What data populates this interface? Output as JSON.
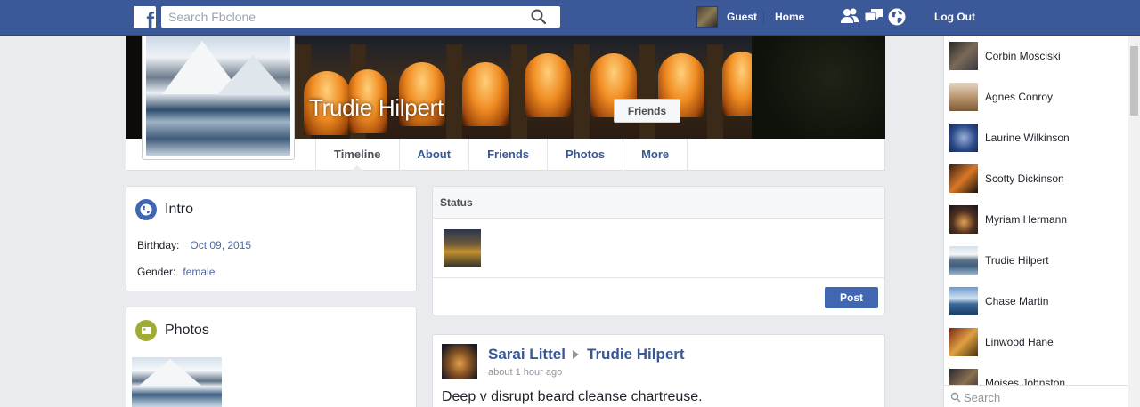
{
  "header": {
    "logo_letter": "f",
    "search_placeholder": "Search Fbclone",
    "user_label": "Guest",
    "home_label": "Home",
    "logout_label": "Log Out",
    "icons": [
      "friend-requests-icon",
      "messages-icon",
      "notifications-globe-icon"
    ]
  },
  "profile": {
    "name": "Trudie Hilpert",
    "friends_button": "Friends",
    "tabs": [
      {
        "label": "Timeline",
        "active": true
      },
      {
        "label": "About",
        "active": false
      },
      {
        "label": "Friends",
        "active": false
      },
      {
        "label": "Photos",
        "active": false
      },
      {
        "label": "More",
        "active": false
      }
    ]
  },
  "intro": {
    "title": "Intro",
    "birthday_label": "Birthday:",
    "birthday_value": "Oct 09, 2015",
    "gender_label": "Gender:",
    "gender_value": "female"
  },
  "photos": {
    "title": "Photos"
  },
  "status": {
    "title": "Status",
    "post_button": "Post"
  },
  "post": {
    "author": "Sarai Littel",
    "target": "Trudie Hilpert",
    "time": "about 1 hour ago",
    "text": "Deep v disrupt beard cleanse chartreuse."
  },
  "contacts": [
    {
      "name": "Corbin Mosciski"
    },
    {
      "name": "Agnes Conroy"
    },
    {
      "name": "Laurine Wilkinson"
    },
    {
      "name": "Scotty Dickinson"
    },
    {
      "name": "Myriam Hermann"
    },
    {
      "name": "Trudie Hilpert"
    },
    {
      "name": "Chase Martin"
    },
    {
      "name": "Linwood Hane"
    },
    {
      "name": "Moises Johnston"
    }
  ],
  "sidebar_search_placeholder": "Search",
  "colors": {
    "brand": "#3b5998",
    "link": "#365899",
    "post_button": "#4267b2",
    "background": "#e9ebee"
  }
}
